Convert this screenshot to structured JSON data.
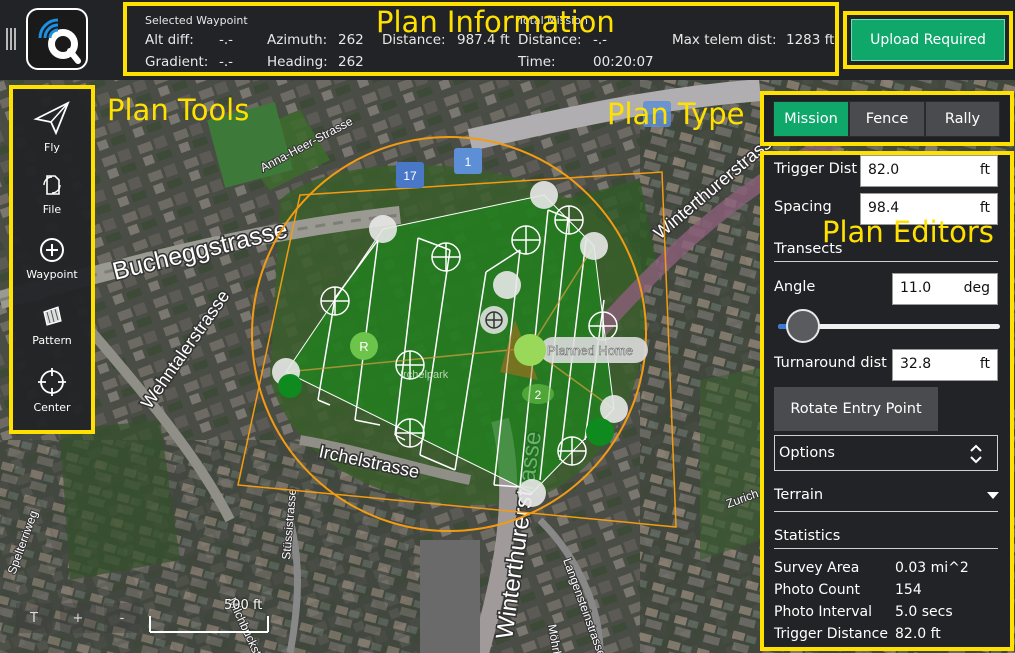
{
  "plan_info": {
    "selected_waypoint_title": "Selected Waypoint",
    "alt_diff_label": "Alt diff:",
    "alt_diff_value": "-.-",
    "gradient_label": "Gradient:",
    "gradient_value": "-.-",
    "azimuth_label": "Azimuth:",
    "azimuth_value": "262",
    "heading_label": "Heading:",
    "heading_value": "262",
    "distance_label": "Distance:",
    "distance_value": "987.4 ft",
    "total_mission_title": "Total Mission",
    "total_distance_label": "Distance:",
    "total_distance_value": "-.-",
    "time_label": "Time:",
    "time_value": "00:20:07",
    "max_telem_label": "Max telem dist:",
    "max_telem_value": "1283 ft"
  },
  "upload_button": "Upload Required",
  "tools": [
    {
      "label": "Fly",
      "icon": "paper-plane-icon"
    },
    {
      "label": "File",
      "icon": "file-sync-icon"
    },
    {
      "label": "Waypoint",
      "icon": "plus-circle-icon"
    },
    {
      "label": "Pattern",
      "icon": "pattern-icon"
    },
    {
      "label": "Center",
      "icon": "crosshair-icon"
    }
  ],
  "plan_type": [
    "Mission",
    "Fence",
    "Rally"
  ],
  "plan_type_selected": "Mission",
  "editors": {
    "trigger_dist_label": "Trigger Dist",
    "trigger_dist_value": "82.0",
    "trigger_dist_unit": "ft",
    "spacing_label": "Spacing",
    "spacing_value": "98.4",
    "spacing_unit": "ft",
    "transects_label": "Transects",
    "angle_label": "Angle",
    "angle_value": "11.0",
    "angle_unit": "deg",
    "angle_slider_fraction": 0.03,
    "turnaround_label": "Turnaround dist",
    "turnaround_value": "32.8",
    "turnaround_unit": "ft",
    "rotate_button": "Rotate Entry Point",
    "options_label": "Options",
    "terrain_label": "Terrain",
    "statistics_label": "Statistics",
    "stats": [
      {
        "label": "Survey Area",
        "value": "0.03 mi^2"
      },
      {
        "label": "Photo Count",
        "value": "154"
      },
      {
        "label": "Photo Interval",
        "value": "5.0 secs"
      },
      {
        "label": "Trigger Distance",
        "value": "82.0 ft"
      }
    ]
  },
  "overlay_labels": {
    "plan_information": "Plan Information",
    "plan_tools": "Plan Tools",
    "plan_type": "Plan Type",
    "plan_editors": "Plan Editors"
  },
  "map": {
    "streets": [
      "Bucheggstrasse",
      "Wehntalerstrasse",
      "Irchelstrasse",
      "Winterthurerstrasse",
      "Anna-Heer-Strasse",
      "Spelterriweg",
      "Langensteinstrasse",
      "Stüssistrasse",
      "Milchbuckstrasse",
      "Zurich",
      "Möhrli"
    ],
    "markers": [
      "17",
      "1",
      "2",
      "R"
    ],
    "home_label": "Planned Home",
    "park_label": "Irchelpark"
  },
  "zoom": [
    "T",
    "+",
    "-"
  ],
  "scale_label": "500 ft",
  "colors": {
    "accent_green": "#10a76b",
    "highlight_yellow": "#ffe100",
    "fence_orange": "#f39c12",
    "survey_green": "#1a8a1a"
  }
}
